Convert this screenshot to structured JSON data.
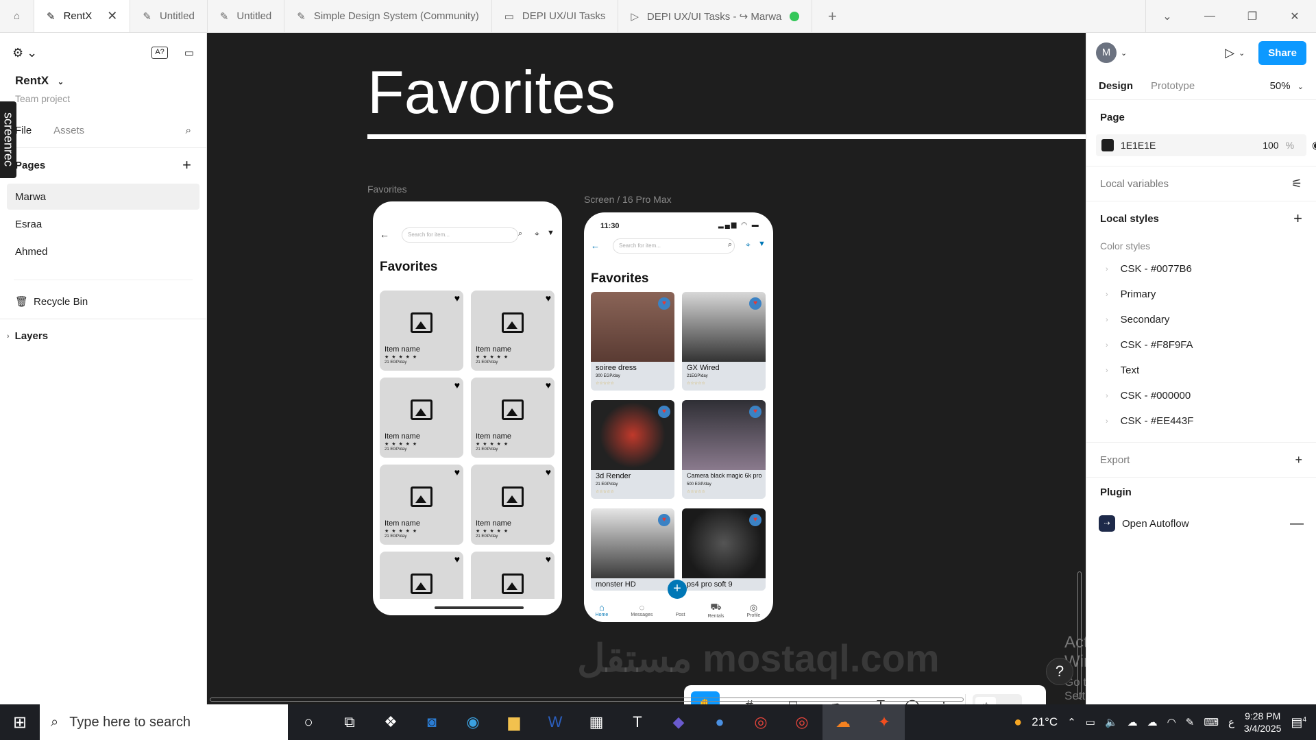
{
  "browser": {
    "tabs": [
      {
        "label": "RentX",
        "active": true
      },
      {
        "label": "Untitled"
      },
      {
        "label": "Untitled"
      },
      {
        "label": "Simple Design System (Community)"
      },
      {
        "label": "DEPI UX/UI Tasks"
      },
      {
        "label": "DEPI UX/UI Tasks - ↪ Marwa"
      }
    ]
  },
  "left": {
    "project_name": "RentX",
    "project_sub": "Team project",
    "tab_file": "File",
    "tab_assets": "Assets",
    "pages_title": "Pages",
    "pages": [
      "Marwa",
      "Esraa",
      "Ahmed"
    ],
    "recycle": "Recycle Bin",
    "layers": "Layers"
  },
  "screenrec": "screenrec",
  "canvas": {
    "big_title": "Favorites",
    "frame1_label": "Favorites",
    "frame2_label": "Screen / 16 Pro Max",
    "wire": {
      "search_placeholder": "Search for item...",
      "title": "Favorites",
      "item_name": "Item name",
      "stars": "★ ★ ★ ★ ★",
      "price": "21 EGP/day"
    },
    "pro": {
      "time": "11:30",
      "search_placeholder": "Search for item...",
      "title": "Favorites",
      "items": [
        {
          "name": "soiree dress",
          "price": "300 EGP/day"
        },
        {
          "name": "GX Wired",
          "price": "21EGP/day"
        },
        {
          "name": "3d Render",
          "price": "21 EGP/day"
        },
        {
          "name": "Camera black magic 6k pro",
          "price": "500 EGP/day"
        },
        {
          "name": "monster HD",
          "price": ""
        },
        {
          "name": "ps4 pro soft 9",
          "price": ""
        }
      ],
      "nav": [
        "Home",
        "Messages",
        "Post",
        "Rentals",
        "Profile"
      ]
    },
    "activate_title": "Activate Windows",
    "activate_sub": "Go to Settings to activate Windows.",
    "watermark": "مستقل mostaql.com"
  },
  "right": {
    "avatar": "M",
    "share": "Share",
    "tab_design": "Design",
    "tab_prototype": "Prototype",
    "zoom": "50%",
    "page_title": "Page",
    "page_color": "1E1E1E",
    "page_opacity": "100",
    "pct": "%",
    "local_variables": "Local variables",
    "local_styles": "Local styles",
    "color_styles": "Color styles",
    "styles": [
      "CSK - #0077B6",
      "Primary",
      "Secondary",
      "CSK - #F8F9FA",
      "Text",
      "CSK - #000000",
      "CSK - #EE443F"
    ],
    "export": "Export",
    "plugin": "Plugin",
    "plugin_item": "Open Autoflow",
    "colors": {
      "accent": "#0d99ff",
      "page_bg": "#1e1e1e"
    }
  },
  "taskbar": {
    "search_placeholder": "Type here to search",
    "weather": "21°C",
    "time": "9:28 PM",
    "date": "3/4/2025",
    "lang": "ع",
    "notif_count": "4"
  }
}
